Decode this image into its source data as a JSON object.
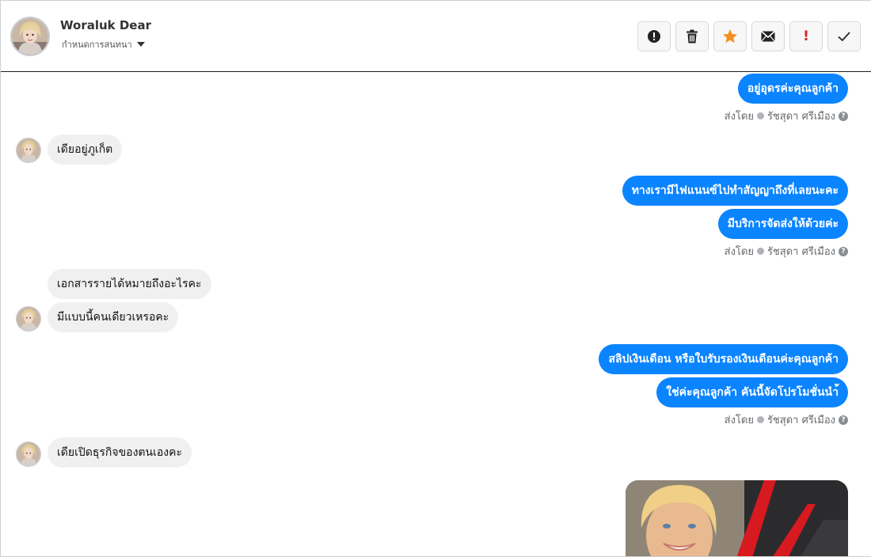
{
  "header": {
    "contact_name": "Woraluk Dear",
    "assign_label": "กำหนดการสนทนา",
    "actions": [
      {
        "name": "spam-alert",
        "icon": "alert-circle-icon"
      },
      {
        "name": "delete",
        "icon": "trash-icon"
      },
      {
        "name": "star",
        "icon": "star-icon",
        "color": "#f4901e"
      },
      {
        "name": "mail",
        "icon": "envelope-icon"
      },
      {
        "name": "important",
        "icon": "exclamation-icon",
        "glyph": "!",
        "color": "#e02020"
      },
      {
        "name": "done",
        "icon": "check-icon"
      }
    ]
  },
  "messages": [
    {
      "dir": "out",
      "text": "อยู่อุดรค่ะคุณลูกค้า"
    },
    {
      "dir": "in",
      "text": "เดียอยู่ภูเก็ต"
    },
    {
      "dir": "out",
      "text": "ทางเรามีไฟแนนซ์ไปทำสัญญาถึงที่เลยนะคะ"
    },
    {
      "dir": "out",
      "text": "มีบริการจัดส่งให้ด้วยค่ะ"
    },
    {
      "dir": "in",
      "text": "เอกสารรายได้หมายถึงอะไรคะ"
    },
    {
      "dir": "in",
      "text": "มีแบบนี้คนเดียวเหรอคะ"
    },
    {
      "dir": "out",
      "text": "สลิปเงินเดือน หรือใบรับรองเงินเดือนค่ะคุณลูกค้า"
    },
    {
      "dir": "out",
      "text": "ใช่ค่ะคุณลูกค้า  คันนี้จัดโปรโมชั่นนำ้"
    },
    {
      "dir": "in",
      "text": "เดียเปิดธุรกิจของตนเองคะ"
    }
  ],
  "sent_by": {
    "prefix": "ส่งโดย",
    "agent_name": "รัชสุดา ศรีเมือง",
    "help_glyph": "?"
  },
  "colors": {
    "outgoing_bubble": "#0b84ff",
    "incoming_bubble": "#f0f0f0",
    "accent_star": "#f4901e",
    "alert_red": "#e02020"
  }
}
